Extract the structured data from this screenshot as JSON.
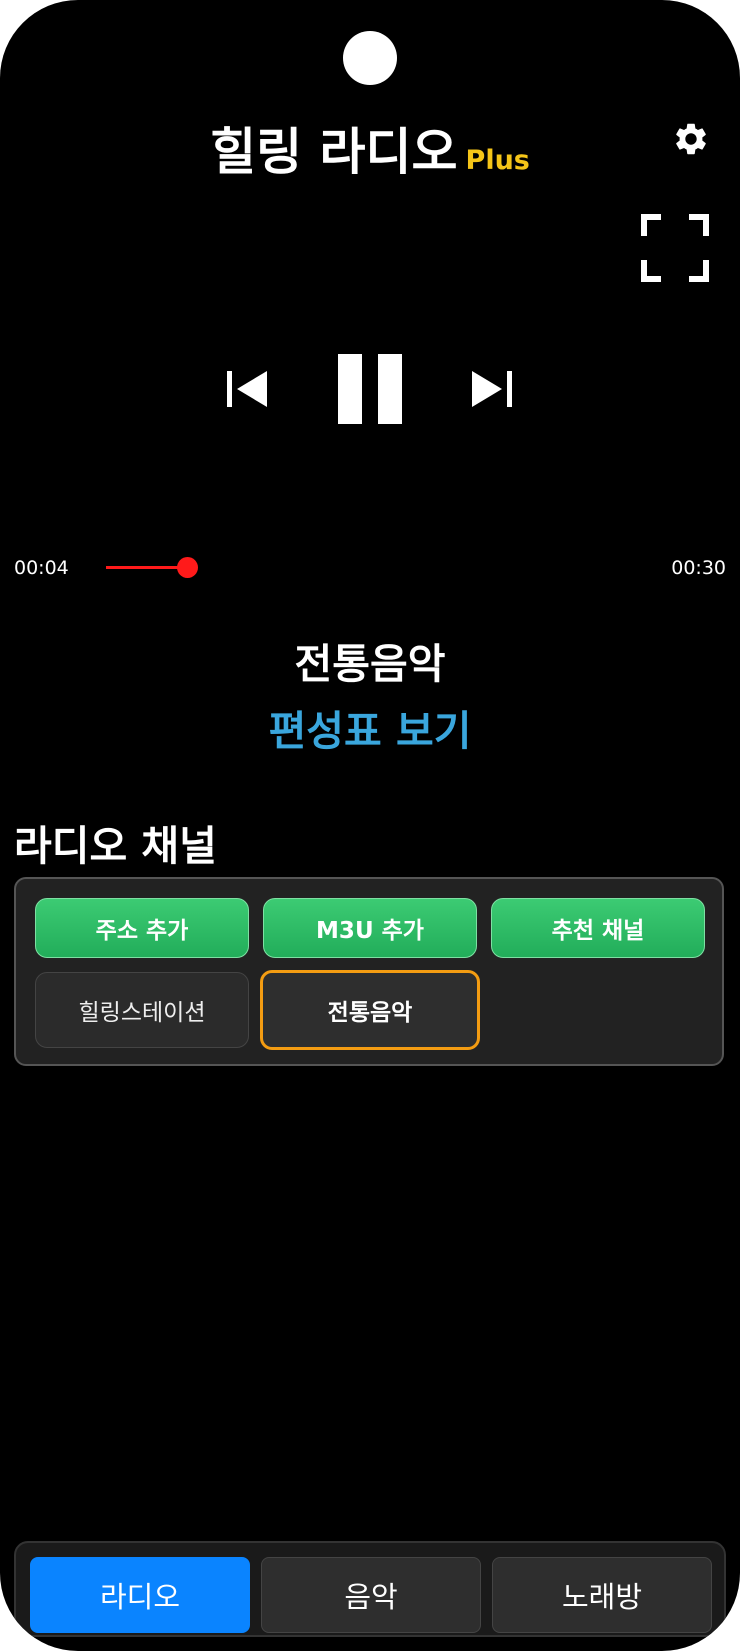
{
  "header": {
    "title": "힐링 라디오",
    "badge": "Plus",
    "settings_icon": "gear-icon",
    "fullscreen_icon": "fullscreen-icon"
  },
  "player": {
    "prev_icon": "skip-previous-icon",
    "pause_icon": "pause-icon",
    "next_icon": "skip-next-icon",
    "elapsed": "00:04",
    "duration": "00:30",
    "progress": 0.15,
    "now_playing": "전통음악",
    "schedule_link": "편성표 보기",
    "accent_color": "#ff1a1a"
  },
  "channels": {
    "section_title": "라디오 채널",
    "actions": [
      {
        "label": "주소 추가"
      },
      {
        "label": "M3U 추가"
      },
      {
        "label": "추천 채널"
      }
    ],
    "items": [
      {
        "label": "힐링스테이션",
        "selected": false
      },
      {
        "label": "전통음악",
        "selected": true
      }
    ]
  },
  "bottom_nav": {
    "tabs": [
      {
        "label": "라디오",
        "active": true
      },
      {
        "label": "음악",
        "active": false
      },
      {
        "label": "노래방",
        "active": false
      }
    ],
    "active_color": "#0a84ff"
  }
}
